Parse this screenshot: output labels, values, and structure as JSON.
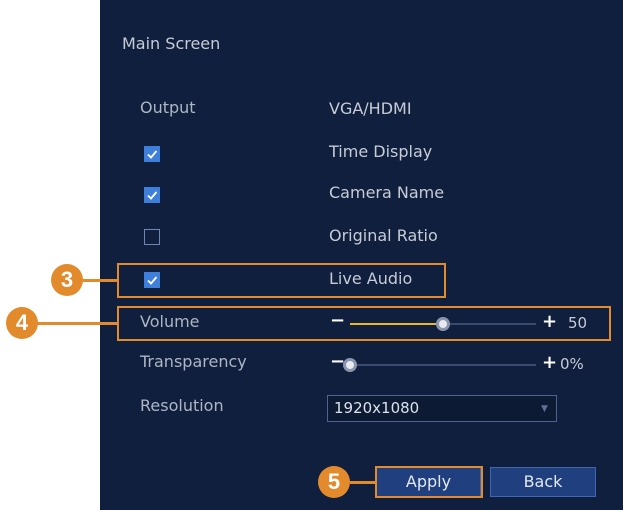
{
  "title": "Main Screen",
  "output": {
    "label": "Output",
    "value": "VGA/HDMI"
  },
  "checkboxes": [
    {
      "label": "Time Display",
      "checked": true
    },
    {
      "label": "Camera Name",
      "checked": true
    },
    {
      "label": "Original Ratio",
      "checked": false
    },
    {
      "label": "Live Audio",
      "checked": true
    }
  ],
  "volume": {
    "label": "Volume",
    "minus": "−",
    "plus": "+",
    "value": "50",
    "level": 0.5
  },
  "transparency": {
    "label": "Transparency",
    "minus": "−",
    "plus": "+",
    "value": "0%",
    "level": 0.0
  },
  "resolution": {
    "label": "Resolution",
    "value": "1920x1080"
  },
  "buttons": {
    "apply": "Apply",
    "back": "Back"
  },
  "callouts": [
    "3",
    "4",
    "5"
  ],
  "colors": {
    "panel": "#0f1f3d",
    "accent": "#e38a2c",
    "check": "#3f7fdc",
    "slider_fill": "#e6b82e"
  }
}
